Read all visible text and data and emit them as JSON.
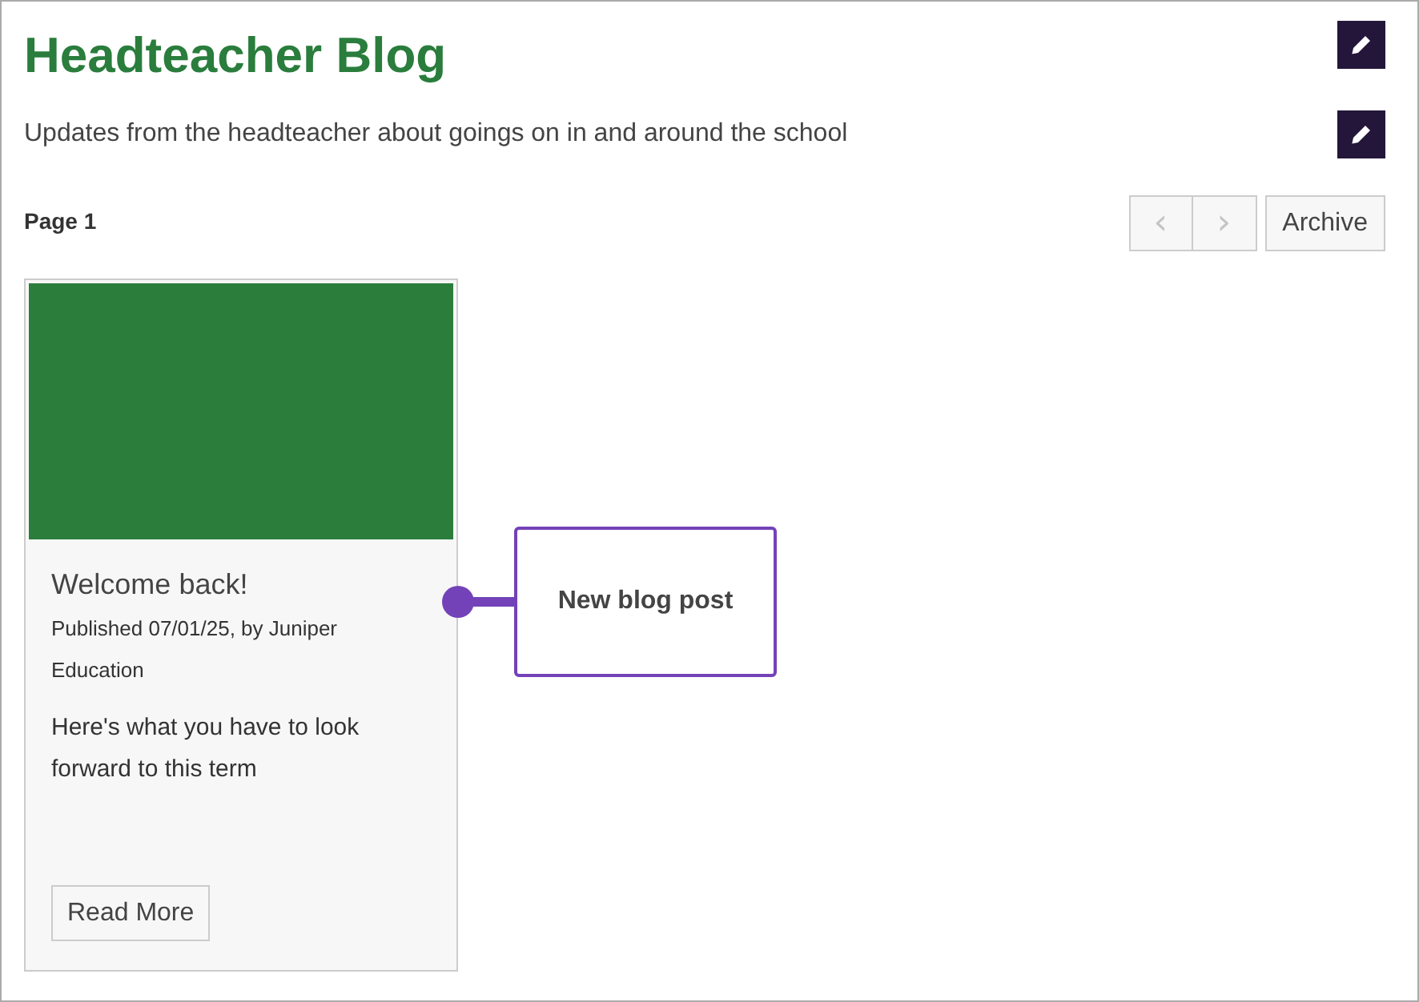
{
  "header": {
    "title": "Headteacher Blog",
    "description": "Updates from the headteacher about goings on in and around the school"
  },
  "page_label": "Page 1",
  "pager": {
    "prev": {
      "label": "‹",
      "disabled": true
    },
    "next": {
      "label": "›",
      "disabled": true
    },
    "archive": "Archive"
  },
  "posts": [
    {
      "title": "Welcome back!",
      "meta": "Published 07/01/25, by Juniper Education",
      "excerpt": "Here's what you have to look forward to this term",
      "button": "Read More"
    }
  ],
  "callout": {
    "text": "New blog post"
  }
}
